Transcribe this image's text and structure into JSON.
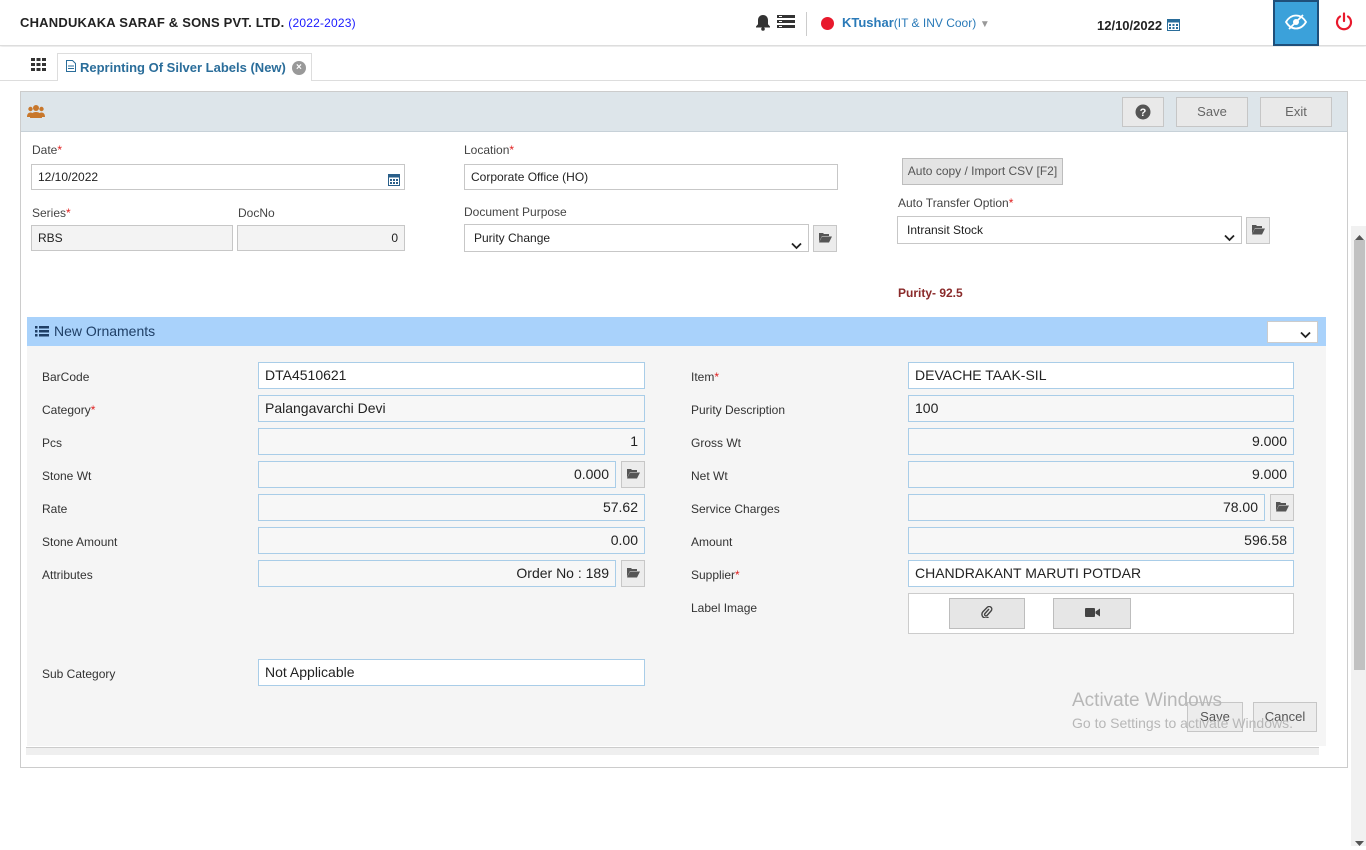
{
  "header": {
    "company": "CHANDUKAKA SARAF & SONS PVT. LTD.",
    "year": "(2022-2023)",
    "user_name": "KTushar",
    "user_role": "(IT & INV Coor)",
    "date": "12/10/2022",
    "status_color": "#e8192c",
    "icons": [
      "bell-icon",
      "list-icon",
      "calendar-icon",
      "eye-slash-icon",
      "power-icon"
    ]
  },
  "tabs": [
    {
      "label": "Reprinting Of Silver Labels (New)"
    }
  ],
  "toolbar": {
    "help_label": "?",
    "save_label": "Save",
    "exit_label": "Exit"
  },
  "form": {
    "date_label": "Date",
    "date_value": "12/10/2022",
    "location_label": "Location",
    "location_value": "Corporate Office (HO)",
    "series_label": "Series",
    "series_value": "RBS",
    "docno_label": "DocNo",
    "docno_value": "0",
    "docpurpose_label": "Document Purpose",
    "docpurpose_value": "Purity Change",
    "autocopy_label": "Auto copy / Import CSV [F2]",
    "autotransfer_label": "Auto Transfer Option",
    "autotransfer_value": "Intransit Stock",
    "purity_text": "Purity- 92.5"
  },
  "section": {
    "title": "New Ornaments",
    "fields_left": [
      {
        "label": "BarCode",
        "value": "DTA4510621"
      },
      {
        "label": "Category",
        "value": "Palangavarchi Devi"
      },
      {
        "label": "Pcs",
        "value": "1"
      },
      {
        "label": "Stone Wt",
        "value": "0.000"
      },
      {
        "label": "Rate",
        "value": "57.62"
      },
      {
        "label": "Stone Amount",
        "value": "0.00"
      },
      {
        "label": "Attributes",
        "value": "Order No : 189"
      }
    ],
    "sub_category_label": "Sub Category",
    "sub_category_value": "Not Applicable",
    "fields_right": [
      {
        "label": "Item",
        "value": "DEVACHE TAAK-SIL"
      },
      {
        "label": "Purity Description",
        "value": "100"
      },
      {
        "label": "Gross Wt",
        "value": "9.000"
      },
      {
        "label": "Net Wt",
        "value": "9.000"
      },
      {
        "label": "Service Charges",
        "value": "78.00"
      },
      {
        "label": "Amount",
        "value": "596.58"
      },
      {
        "label": "Supplier",
        "value": "CHANDRAKANT MARUTI POTDAR"
      }
    ],
    "label_image_label": "Label Image"
  },
  "footer": {
    "save_label": "Save",
    "cancel_label": "Cancel"
  },
  "watermark": {
    "line1": "Activate Windows",
    "line2": "Go to Settings to activate Windows."
  }
}
